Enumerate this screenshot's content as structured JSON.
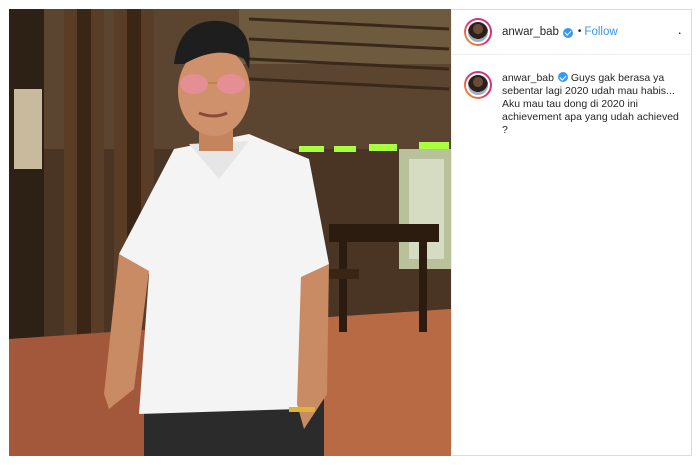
{
  "post": {
    "username": "anwar_bab",
    "follow_label": "Follow",
    "dot": "•",
    "more": "·",
    "caption_user": "anwar_bab",
    "caption_text": "Guys gak berasa ya sebentar lagi 2020 udah mau habis... Aku mau tau dong di 2020 ini achievement apa yang udah achieved ?"
  },
  "colors": {
    "accent": "#3897f0",
    "border": "#dbdbdb"
  },
  "icons": {
    "verified": "verified-badge-icon",
    "more": "more-options-icon"
  }
}
